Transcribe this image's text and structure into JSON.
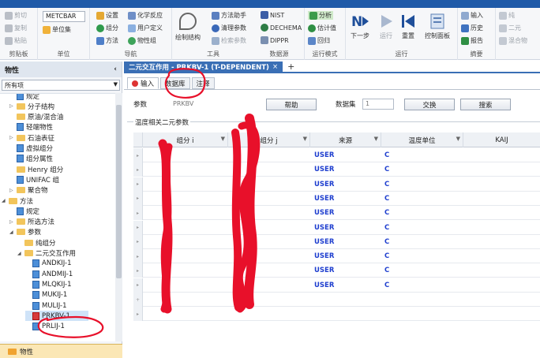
{
  "ribbon": {
    "clipboard": {
      "cut": "剪切",
      "copy": "复制",
      "paste": "粘贴",
      "label": "剪贴板"
    },
    "units": {
      "combo_value": "METCBAR",
      "unit_set": "单位集",
      "label": "单位"
    },
    "nav": {
      "setup": "设置",
      "chem_reactions": "化学反应",
      "component": "组分",
      "user_defined": "用户定义",
      "method": "方法",
      "property_set": "物性组",
      "label": "导航"
    },
    "tools": {
      "draw_structure": "绘制结构",
      "method_assistant": "方法助手",
      "clear_params": "清理参数",
      "retrieve_params": "检索参数",
      "nist": "NIST",
      "dechema": "DECHEMA",
      "dippr": "DIPPR",
      "label": "工具",
      "source_label": "数据源"
    },
    "run_mode": {
      "analysis": "分析",
      "estimation": "估计值",
      "regression": "回归",
      "label": "运行模式"
    },
    "run": {
      "next": "下一步",
      "run": "运行",
      "reset": "重置",
      "control_panel": "控制面板",
      "label": "运行"
    },
    "summary": {
      "input": "输入",
      "history": "历史",
      "report": "报告",
      "label": "摘要"
    },
    "extra": {
      "pure": "纯",
      "binary": "二元",
      "mixture": "混合物"
    }
  },
  "left_panel": {
    "title": "物性",
    "filter": "所有项",
    "tree": [
      {
        "label": "规定",
        "type": "sheet",
        "indent": 2
      },
      {
        "label": "分子结构",
        "type": "folder",
        "indent": 2,
        "toggle": "▷"
      },
      {
        "label": "原油/混合油",
        "type": "folder",
        "indent": 2
      },
      {
        "label": "轻端物性",
        "type": "sheet",
        "indent": 2
      },
      {
        "label": "石油表征",
        "type": "folder",
        "indent": 2,
        "toggle": "▷"
      },
      {
        "label": "虚拟组分",
        "type": "sheet",
        "indent": 2
      },
      {
        "label": "组分属性",
        "type": "sheet",
        "indent": 2
      },
      {
        "label": "Henry 组分",
        "type": "folder",
        "indent": 2
      },
      {
        "label": "UNIFAC 组",
        "type": "sheet",
        "indent": 2
      },
      {
        "label": "聚合物",
        "type": "folder",
        "indent": 2,
        "toggle": "▷"
      },
      {
        "label": "方法",
        "type": "folder",
        "indent": 1,
        "toggle": "◢"
      },
      {
        "label": "规定",
        "type": "sheet",
        "indent": 2
      },
      {
        "label": "所选方法",
        "type": "folder",
        "indent": 2,
        "toggle": "▷"
      },
      {
        "label": "参数",
        "type": "folder",
        "indent": 2,
        "toggle": "◢"
      },
      {
        "label": "纯组分",
        "type": "folder",
        "indent": 3
      },
      {
        "label": "二元交互作用",
        "type": "folder",
        "indent": 3,
        "toggle": "◢"
      },
      {
        "label": "ANDKIJ-1",
        "type": "sheet",
        "indent": 4
      },
      {
        "label": "ANDMIJ-1",
        "type": "sheet",
        "indent": 4
      },
      {
        "label": "MLQKIJ-1",
        "type": "sheet",
        "indent": 4
      },
      {
        "label": "MUKIJ-1",
        "type": "sheet",
        "indent": 4
      },
      {
        "label": "MULIJ-1",
        "type": "sheet",
        "indent": 4
      },
      {
        "label": "PRKBV-1",
        "type": "sheet-red",
        "indent": 4,
        "selected": true
      },
      {
        "label": "PRLIJ-1",
        "type": "sheet",
        "indent": 4
      }
    ],
    "bottom_label": "物性"
  },
  "document": {
    "tab_title": "二元交互作用 - PRKBV-1 (T-DEPENDENT)",
    "tab_close": "×",
    "new_tab": "+",
    "subtabs": [
      "输入",
      "数据库",
      "注释"
    ],
    "param_label": "参数",
    "param_value": "PRKBV",
    "help_button": "帮助",
    "dataset_label": "数据集",
    "dataset_value": "1",
    "swap_button": "交换",
    "search_button": "搜索",
    "group_title": "温度相关二元参数",
    "columns": [
      "组分 i",
      "组分 j",
      "来源",
      "温度单位",
      "KAIJ"
    ],
    "rows": [
      {
        "source": "USER",
        "unit": "C"
      },
      {
        "source": "USER",
        "unit": "C"
      },
      {
        "source": "USER",
        "unit": "C"
      },
      {
        "source": "USER",
        "unit": "C"
      },
      {
        "source": "USER",
        "unit": "C"
      },
      {
        "source": "USER",
        "unit": "C"
      },
      {
        "source": "USER",
        "unit": "C"
      },
      {
        "source": "USER",
        "unit": "C"
      },
      {
        "source": "USER",
        "unit": "C"
      },
      {
        "source": "USER",
        "unit": "C"
      }
    ]
  },
  "colors": {
    "accent": "#3a6fb5",
    "source_text": "#1f3fcf",
    "annotation_red": "#e8102a"
  }
}
